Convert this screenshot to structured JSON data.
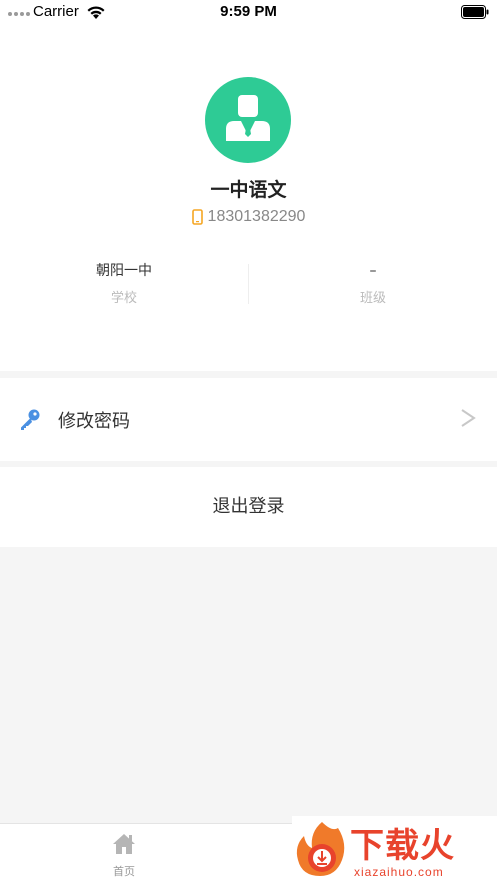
{
  "status_bar": {
    "carrier": "Carrier",
    "time": "9:59 PM"
  },
  "profile": {
    "name": "一中语文",
    "phone": "18301382290",
    "school_value": "朝阳一中",
    "school_label": "学校",
    "class_value": "–",
    "class_label": "班级"
  },
  "menu": {
    "change_password": "修改密码"
  },
  "logout_label": "退出登录",
  "tab_bar": {
    "home_label": "首页"
  },
  "watermark": {
    "brand": "下载火",
    "url": "xiazaihuo.com"
  },
  "colors": {
    "accent_green": "#2ecb95",
    "phone_icon": "#f5a623",
    "key_icon": "#4a90e2",
    "brand_red": "#e8432c"
  }
}
